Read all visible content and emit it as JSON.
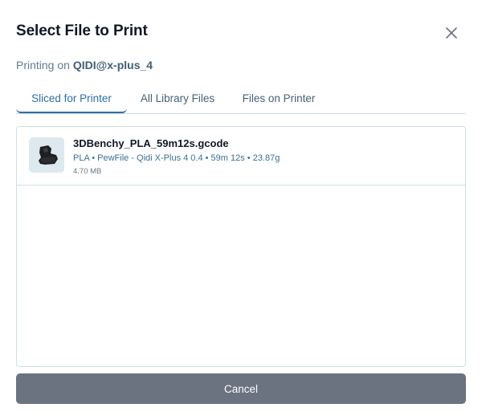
{
  "dialog": {
    "title": "Select File to Print",
    "close_icon": "close-icon"
  },
  "subtitle": {
    "prefix": "Printing on ",
    "printer_name": "QIDI@x-plus_4"
  },
  "tabs": [
    {
      "label": "Sliced for Printer",
      "active": true
    },
    {
      "label": "All Library Files",
      "active": false
    },
    {
      "label": "Files on Printer",
      "active": false
    }
  ],
  "files": [
    {
      "name": "3DBenchy_PLA_59m12s.gcode",
      "meta": "PLA • PewFile - Qidi X-Plus 4 0.4 • 59m 12s • 23.87g",
      "size": "4.70 MB",
      "thumbnail_icon": "benchy-thumbnail-icon"
    }
  ],
  "footer": {
    "cancel_label": "Cancel"
  },
  "colors": {
    "accent": "#2e6fa7",
    "meta_text": "#3c6f98",
    "cancel_bg": "#6b7280",
    "border": "#cfe0e5"
  }
}
